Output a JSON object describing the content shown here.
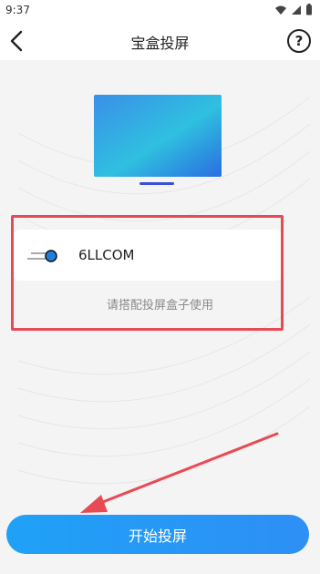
{
  "status_bar": {
    "time": "9:37"
  },
  "header": {
    "title": "宝盒投屏"
  },
  "input": {
    "value": "6LLCOM"
  },
  "hint_text": "请搭配投屏盒子使用",
  "start_button_label": "开始投屏",
  "colors": {
    "accent": "#2196F3",
    "annotation_red": "#E84A55",
    "screen_blue": "#2A7BE6"
  }
}
